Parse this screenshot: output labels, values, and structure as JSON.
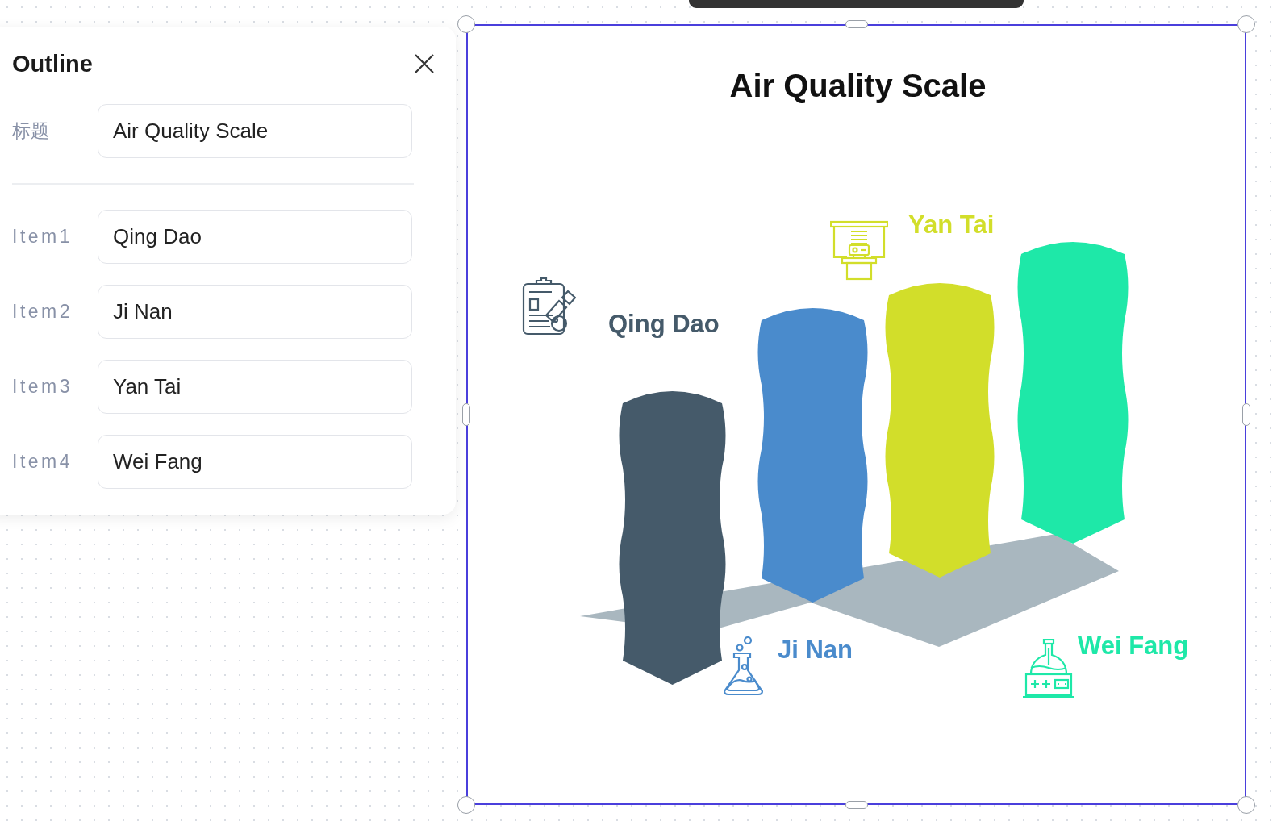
{
  "outline": {
    "title": "Outline",
    "title_field": {
      "label": "标题",
      "value": "Air Quality Scale"
    },
    "items": [
      {
        "label": "Item1",
        "value": "Qing Dao"
      },
      {
        "label": "Item2",
        "value": "Ji Nan"
      },
      {
        "label": "Item3",
        "value": "Yan Tai"
      },
      {
        "label": "Item4",
        "value": "Wei Fang"
      }
    ]
  },
  "infographic": {
    "title": "Air Quality Scale",
    "items": [
      {
        "label": "Qing Dao",
        "color": "#455a6a",
        "kind": "clipboard"
      },
      {
        "label": "Ji Nan",
        "color": "#4a8bcc",
        "kind": "flask"
      },
      {
        "label": "Yan Tai",
        "color": "#d2de2a",
        "kind": "projector"
      },
      {
        "label": "Wei Fang",
        "color": "#1ee8a8",
        "kind": "lab-device"
      }
    ]
  }
}
